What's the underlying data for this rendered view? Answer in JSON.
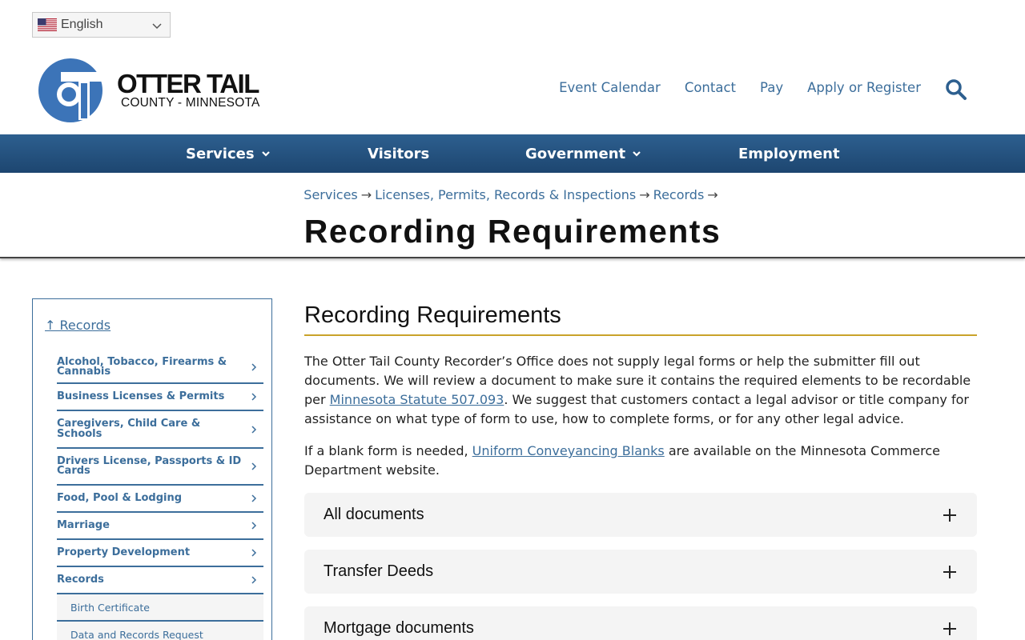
{
  "language": {
    "selected": "English"
  },
  "logo": {
    "name": "OTTER TAIL",
    "subtitle": "COUNTY - MINNESOTA"
  },
  "utility_nav": [
    "Event Calendar",
    "Contact",
    "Pay",
    "Apply or Register"
  ],
  "main_nav": [
    {
      "label": "Services",
      "has_dropdown": true
    },
    {
      "label": "Visitors",
      "has_dropdown": false
    },
    {
      "label": "Government",
      "has_dropdown": true
    },
    {
      "label": "Employment",
      "has_dropdown": false
    }
  ],
  "breadcrumb": [
    "Services",
    "Licenses, Permits, Records & Inspections",
    "Records"
  ],
  "breadcrumb_separator": "→",
  "page_title": "Recording Requirements",
  "sidebar": {
    "up_link": "↑ Records",
    "items": [
      "Alcohol, Tobacco, Firearms & Cannabis",
      "Business Licenses & Permits",
      "Caregivers, Child Care & Schools",
      "Drivers License, Passports & ID Cards",
      "Food, Pool & Lodging",
      "Marriage",
      "Property Development",
      "Records"
    ],
    "sub_items": [
      "Birth Certificate",
      "Data and Records Request"
    ]
  },
  "content": {
    "heading": "Recording Requirements",
    "p1_before": "The Otter Tail County Recorder’s Office does not supply legal forms or help the submitter fill out documents. We will review a document to make sure it contains the required elements to be recordable per ",
    "p1_link": "Minnesota Statute 507.093",
    "p1_after": ". We suggest that customers contact a legal advisor or title company for assistance on what type of form to use, how to complete forms, or for any other legal advice.",
    "p2_before": "If a blank form is needed, ",
    "p2_link": "Uniform Conveyancing Blanks",
    "p2_after": " are available on the Minnesota Commerce Department website.",
    "accordion": [
      "All documents",
      "Transfer Deeds",
      "Mortgage documents"
    ]
  },
  "colors": {
    "brand_blue": "#3c6e9b",
    "nav_bar": "#24527f",
    "accent_gold": "#c9a32a"
  }
}
